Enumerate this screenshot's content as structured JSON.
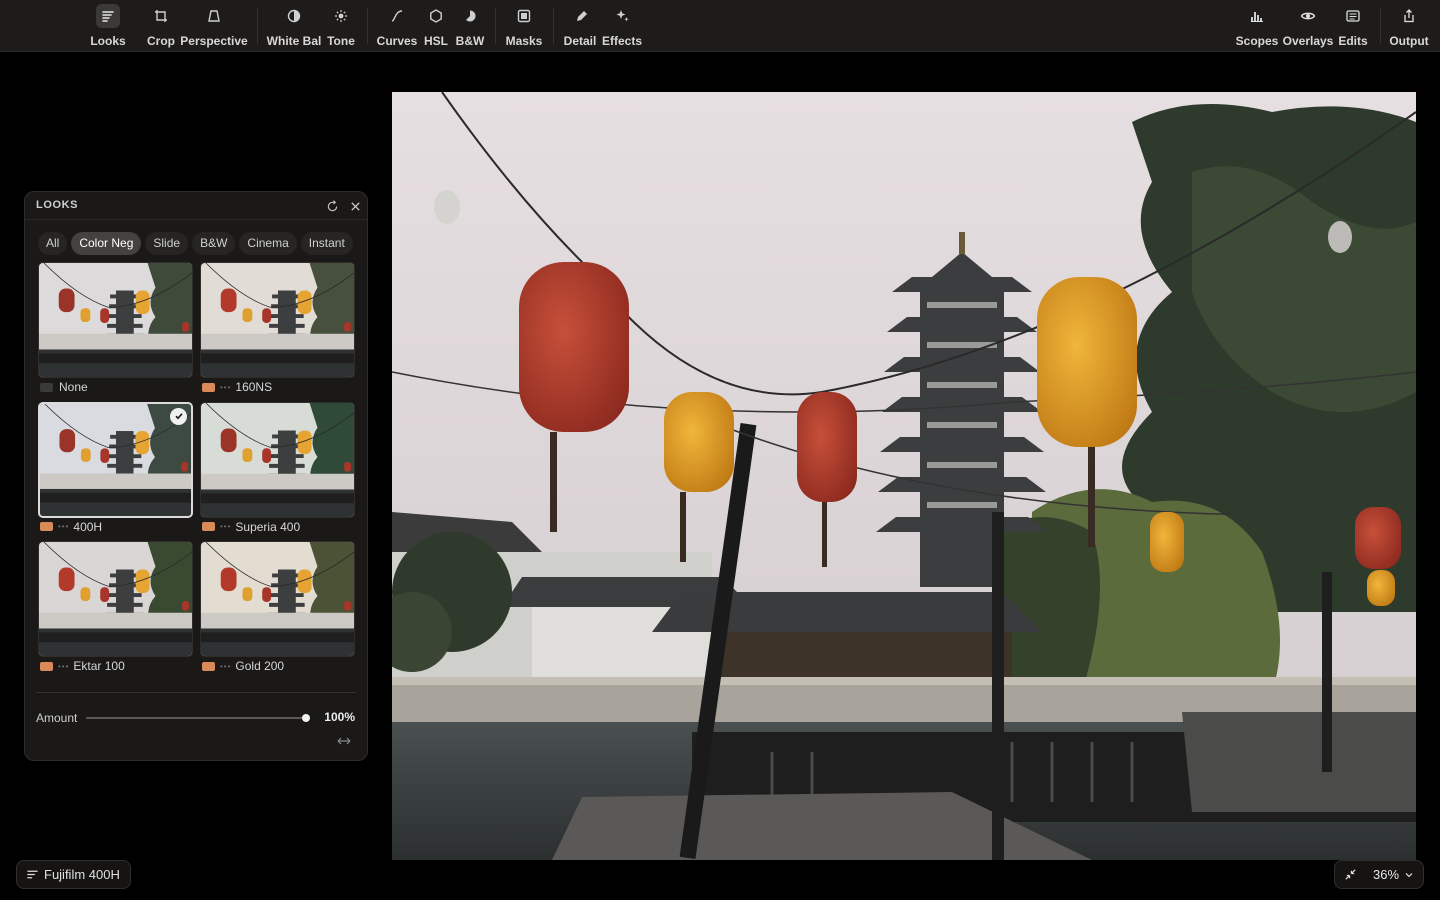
{
  "toolbar": {
    "tools": [
      {
        "label": "Looks",
        "icon": "looks-icon"
      },
      {
        "label": "Crop",
        "icon": "crop-icon"
      },
      {
        "label": "Perspective",
        "icon": "perspective-icon"
      },
      {
        "label": "White Bal",
        "icon": "white-balance-icon"
      },
      {
        "label": "Tone",
        "icon": "tone-icon"
      },
      {
        "label": "Curves",
        "icon": "curves-icon"
      },
      {
        "label": "HSL",
        "icon": "hsl-icon"
      },
      {
        "label": "B&W",
        "icon": "bw-icon"
      },
      {
        "label": "Masks",
        "icon": "masks-icon"
      },
      {
        "label": "Detail",
        "icon": "detail-icon"
      },
      {
        "label": "Effects",
        "icon": "effects-icon"
      }
    ],
    "right_tools": [
      {
        "label": "Scopes",
        "icon": "scopes-icon"
      },
      {
        "label": "Overlays",
        "icon": "overlays-icon"
      },
      {
        "label": "Edits",
        "icon": "edits-icon"
      },
      {
        "label": "Output",
        "icon": "output-icon"
      }
    ],
    "active": "Looks"
  },
  "looks_panel": {
    "title": "LOOKS",
    "categories": [
      "All",
      "Color Neg",
      "Slide",
      "B&W",
      "Cinema",
      "Instant"
    ],
    "active_category": "Color Neg",
    "looks": [
      {
        "name": "None",
        "swatch": "#3a3a38",
        "selected": false,
        "tint": "none"
      },
      {
        "name": "160NS",
        "swatch": "#d98a58",
        "selected": false,
        "tint": "warm"
      },
      {
        "name": "400H",
        "swatch": "#d98a58",
        "selected": true,
        "tint": "cool"
      },
      {
        "name": "Superia 400",
        "swatch": "#d98a58",
        "selected": false,
        "tint": "green"
      },
      {
        "name": "Ektar 100",
        "swatch": "#d98a58",
        "selected": false,
        "tint": "vivid"
      },
      {
        "name": "Gold 200",
        "swatch": "#d98a58",
        "selected": false,
        "tint": "gold"
      }
    ],
    "amount": {
      "label": "Amount",
      "value": "100%",
      "fraction": 1.0
    }
  },
  "bottom": {
    "current_look": "Fujifilm 400H",
    "zoom": "36%"
  },
  "colors": {
    "toolbar_bg": "#1d1c1a",
    "panel_bg": "#1a1918",
    "accent_swatch": "#d98a58"
  }
}
